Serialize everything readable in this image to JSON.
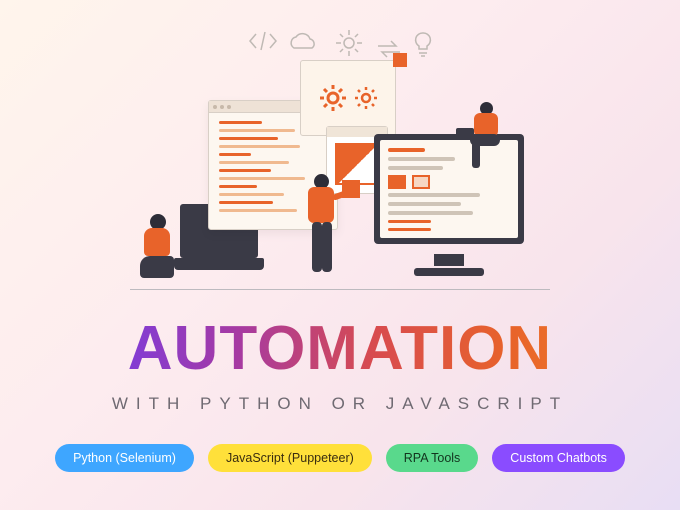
{
  "headline": "AUTOMATION",
  "subline": "WITH PYTHON OR JAVASCRIPT",
  "pills": [
    {
      "label": "Python (Selenium)",
      "color": "blue"
    },
    {
      "label": "JavaScript (Puppeteer)",
      "color": "yellow"
    },
    {
      "label": "RPA Tools",
      "color": "green"
    },
    {
      "label": "Custom Chatbots",
      "color": "purple"
    }
  ],
  "palette": {
    "accent_orange": "#e8632a",
    "gradient_start": "#6a3cf5",
    "gradient_end": "#f38b2b"
  },
  "sketch_icons": [
    "code-bracket",
    "cloud",
    "gear",
    "lightbulb",
    "arrows-loop"
  ]
}
